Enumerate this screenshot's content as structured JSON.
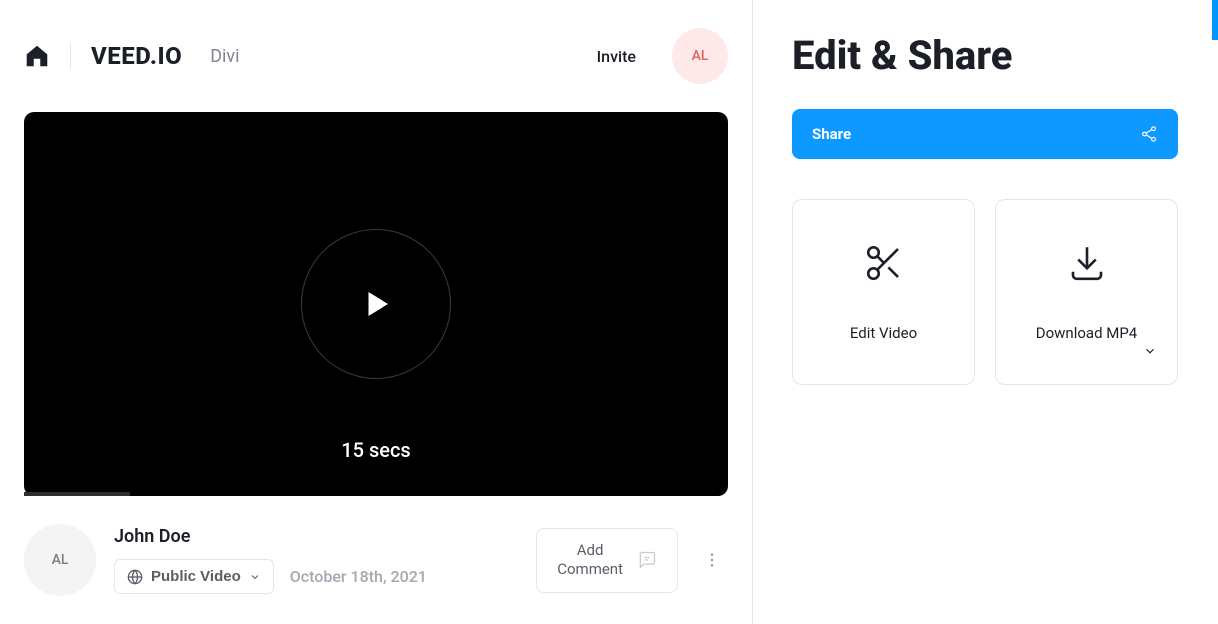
{
  "header": {
    "brand": "VEED.IO",
    "project_name": "Divi",
    "invite_label": "Invite",
    "avatar_initials": "AL"
  },
  "video": {
    "duration": "15 secs"
  },
  "meta": {
    "avatar_initials": "AL",
    "author": "John Doe",
    "visibility_label": "Public Video",
    "date": "October 18th, 2021",
    "add_comment_label": "Add\nComment"
  },
  "right": {
    "title": "Edit & Share",
    "share_label": "Share",
    "edit_label": "Edit Video",
    "download_label": "Download MP4"
  }
}
